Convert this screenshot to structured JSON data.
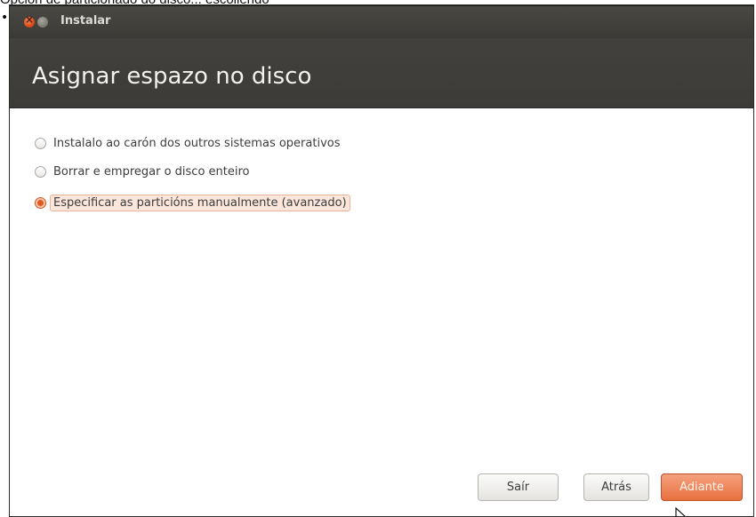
{
  "page": {
    "caption": "Opción de particionado do disco... escollendo"
  },
  "window": {
    "title": "Instalar",
    "heading": "Asignar espazo no disco"
  },
  "options": [
    {
      "label": "Instalalo ao carón dos outros sistemas operativos",
      "checked": false
    },
    {
      "label": "Borrar e empregar o disco enteiro",
      "checked": false
    },
    {
      "label": "Especificar as particións manualmente (avanzado)",
      "checked": true
    }
  ],
  "buttons": {
    "quit": "Saír",
    "back": "Atrás",
    "forward": "Adiante"
  },
  "colors": {
    "accent": "#e8703f",
    "header_bg": "#3c3b37",
    "titlebar_text": "#dcdad5"
  }
}
